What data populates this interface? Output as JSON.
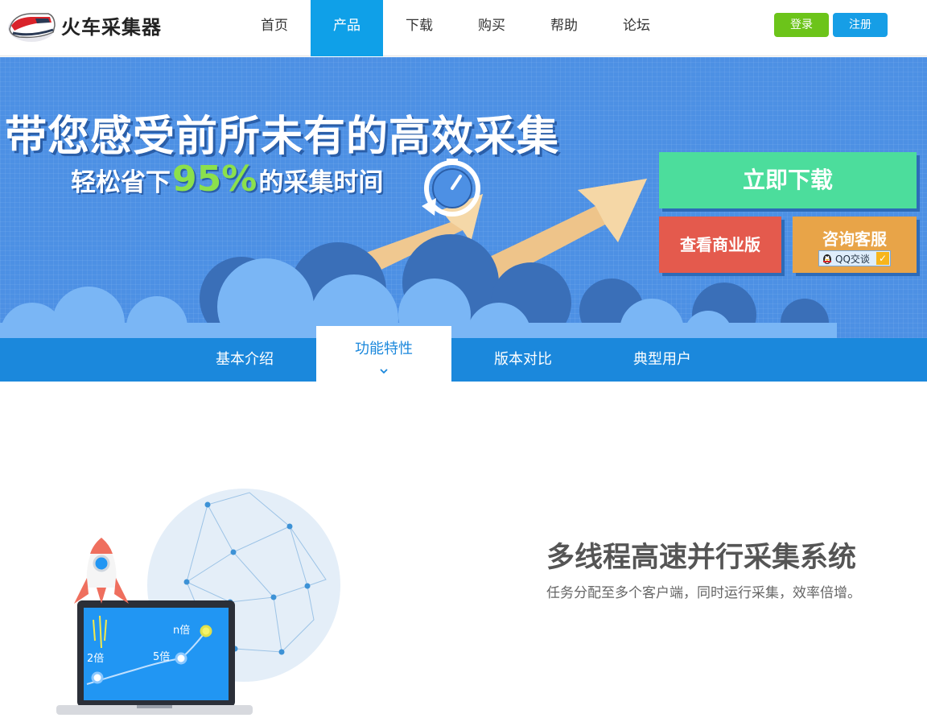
{
  "header": {
    "logo_text": "火车采集器",
    "nav": [
      {
        "label": "首页"
      },
      {
        "label": "产品"
      },
      {
        "label": "下载"
      },
      {
        "label": "购买"
      },
      {
        "label": "帮助"
      },
      {
        "label": "论坛"
      }
    ],
    "active_nav": "产品",
    "login_label": "登录",
    "register_label": "注册",
    "login_color": "#6cc41a",
    "register_color": "#169ee6"
  },
  "banner": {
    "headline": "带您感受前所未有的高效采集",
    "subline_prefix": "轻松省下",
    "subline_percent": "95%",
    "subline_suffix": "的采集时间",
    "download_label": "立即下载",
    "business_label": "查看商业版",
    "service_label": "咨询客服",
    "qq_label": "QQ交谈",
    "colors": {
      "background": "#4d90e4",
      "download": "#4cdd9c",
      "business": "#e45a4d",
      "service": "#e8a448",
      "percent": "#8be04c"
    }
  },
  "subtabs": {
    "items": [
      {
        "label": "基本介绍"
      },
      {
        "label": "功能特性"
      },
      {
        "label": "版本对比"
      },
      {
        "label": "典型用户"
      }
    ],
    "active": "功能特性"
  },
  "feature": {
    "title": "多线程高速并行采集系统",
    "description": "任务分配至多个客户端，同时运行采集，效率倍增。",
    "chart_labels": [
      "2倍",
      "5倍",
      "n倍"
    ]
  }
}
